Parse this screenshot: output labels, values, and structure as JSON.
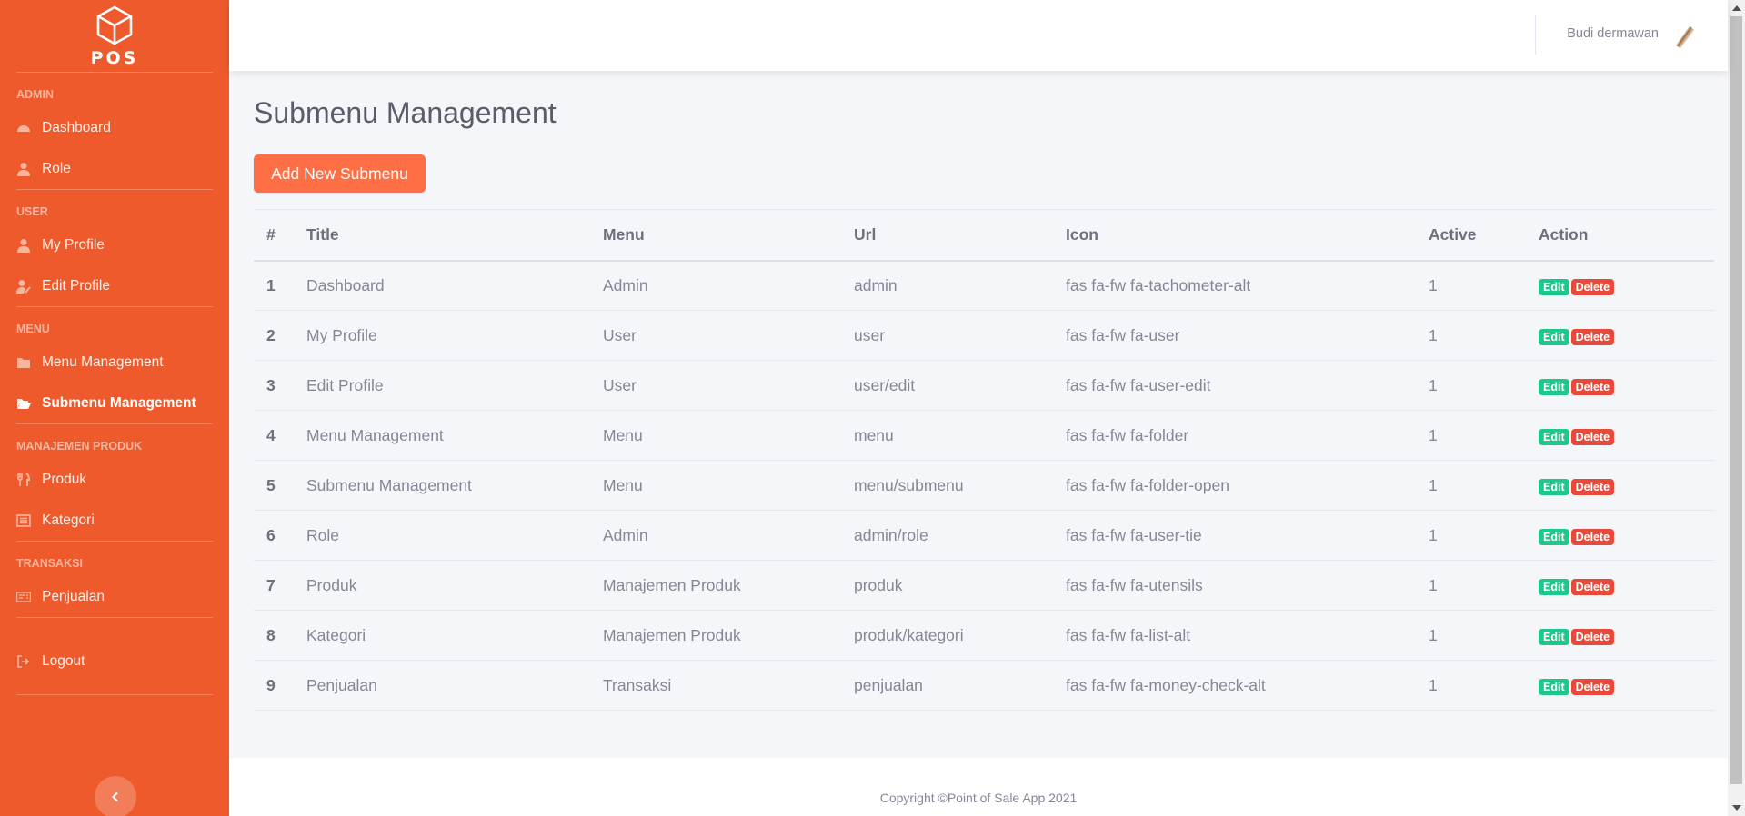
{
  "brand": {
    "name": "POS",
    "logo_icon": "cube-icon"
  },
  "sidebar": {
    "sections": [
      {
        "heading": "ADMIN",
        "items": [
          {
            "label": "Dashboard",
            "icon": "tachometer-icon"
          },
          {
            "label": "Role",
            "icon": "user-tie-icon"
          }
        ]
      },
      {
        "heading": "USER",
        "items": [
          {
            "label": "My Profile",
            "icon": "user-icon"
          },
          {
            "label": "Edit Profile",
            "icon": "user-edit-icon"
          }
        ]
      },
      {
        "heading": "MENU",
        "items": [
          {
            "label": "Menu Management",
            "icon": "folder-icon"
          },
          {
            "label": "Submenu Management",
            "icon": "folder-open-icon",
            "active": true
          }
        ]
      },
      {
        "heading": "MANAJEMEN PRODUK",
        "items": [
          {
            "label": "Produk",
            "icon": "utensils-icon"
          },
          {
            "label": "Kategori",
            "icon": "list-alt-icon"
          }
        ]
      },
      {
        "heading": "TRANSAKSI",
        "items": [
          {
            "label": "Penjualan",
            "icon": "money-check-icon"
          }
        ]
      }
    ],
    "logout_label": "Logout",
    "toggle_icon": "chevron-left-icon"
  },
  "topbar": {
    "user_name": "Budi dermawan"
  },
  "page": {
    "title": "Submenu Management",
    "add_button": "Add New Submenu"
  },
  "table": {
    "headers": [
      "#",
      "Title",
      "Menu",
      "Url",
      "Icon",
      "Active",
      "Action"
    ],
    "rows": [
      [
        "1",
        "Dashboard",
        "Admin",
        "admin",
        "fas fa-fw fa-tachometer-alt",
        "1"
      ],
      [
        "2",
        "My Profile",
        "User",
        "user",
        "fas fa-fw fa-user",
        "1"
      ],
      [
        "3",
        "Edit Profile",
        "User",
        "user/edit",
        "fas fa-fw fa-user-edit",
        "1"
      ],
      [
        "4",
        "Menu Management",
        "Menu",
        "menu",
        "fas fa-fw fa-folder",
        "1"
      ],
      [
        "5",
        "Submenu Management",
        "Menu",
        "menu/submenu",
        "fas fa-fw fa-folder-open",
        "1"
      ],
      [
        "6",
        "Role",
        "Admin",
        "admin/role",
        "fas fa-fw fa-user-tie",
        "1"
      ],
      [
        "7",
        "Produk",
        "Manajemen Produk",
        "produk",
        "fas fa-fw fa-utensils",
        "1"
      ],
      [
        "8",
        "Kategori",
        "Manajemen Produk",
        "produk/kategori",
        "fas fa-fw fa-list-alt",
        "1"
      ],
      [
        "9",
        "Penjualan",
        "Transaksi",
        "penjualan",
        "fas fa-fw fa-money-check-alt",
        "1"
      ]
    ],
    "edit_label": "Edit",
    "delete_label": "Delete"
  },
  "footer": {
    "copyright": "Copyright ©Point of Sale App 2021"
  },
  "colors": {
    "sidebar": "#ee5a2b",
    "primary_button": "#ff6f45",
    "edit_badge": "#1cc88a",
    "delete_badge": "#e74a3b"
  }
}
